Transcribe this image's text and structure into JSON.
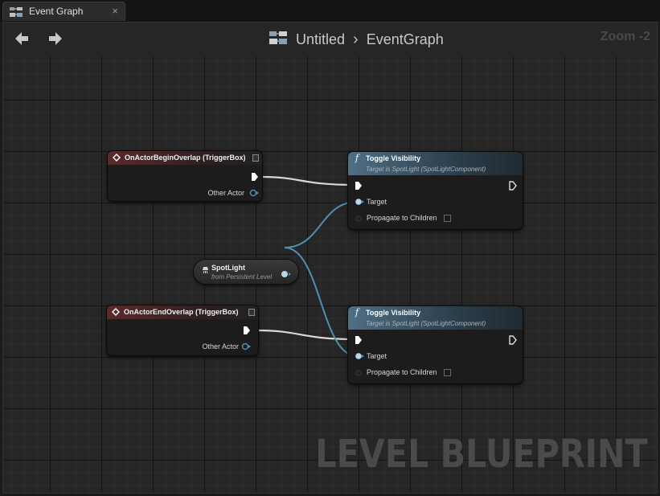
{
  "tab": {
    "title": "Event Graph",
    "close_glyph": "×",
    "icon": "blueprint-graph-icon"
  },
  "header": {
    "back_icon": "back-arrow-icon",
    "forward_icon": "forward-arrow-icon",
    "breadcrumb": {
      "icon": "blueprint-graph-icon",
      "root": "Untitled",
      "separator": "›",
      "current": "EventGraph"
    },
    "zoom": "Zoom -2"
  },
  "nodes": {
    "begin_overlap": {
      "title": "OnActorBeginOverlap (TriggerBox)",
      "pin_other_actor": "Other Actor"
    },
    "end_overlap": {
      "title": "OnActorEndOverlap (TriggerBox)",
      "pin_other_actor": "Other Actor"
    },
    "spotlight": {
      "title": "SpotLight",
      "subtitle": "from Persistent Level"
    },
    "toggle_1": {
      "title": "Toggle Visibility",
      "subtitle": "Target is SpotLight (SpotLightComponent)",
      "func_glyph": "f",
      "pin_target": "Target",
      "pin_propagate": "Propagate to Children"
    },
    "toggle_2": {
      "title": "Toggle Visibility",
      "subtitle": "Target is SpotLight (SpotLightComponent)",
      "func_glyph": "f",
      "pin_target": "Target",
      "pin_propagate": "Propagate to Children"
    }
  },
  "watermark": "LEVEL BLUEPRINT",
  "colors": {
    "exec_wire": "#d8d8d8",
    "object_wire": "#4f8fb0",
    "event_header": "#5b2a2a",
    "function_header": "#4e6f85"
  }
}
